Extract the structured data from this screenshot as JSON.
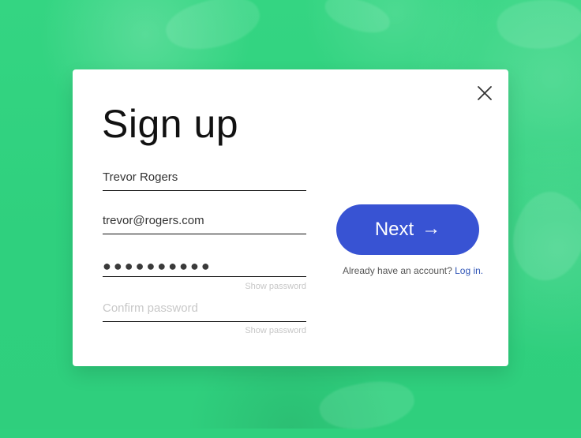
{
  "background": {
    "color": "#2fd07e"
  },
  "modal": {
    "title": "Sign up",
    "close_icon": "close-icon",
    "fields": {
      "name_value": "Trevor Rogers",
      "email_value": "trevor@rogers.com",
      "password_mask": "●●●●●●●●●●",
      "confirm_placeholder": "Confirm password",
      "show_password_label": "Show password"
    },
    "next_button": {
      "label": "Next",
      "icon": "→",
      "color": "#3853d3"
    },
    "login_prompt": {
      "text": "Already have an account?",
      "link": "Log in."
    }
  }
}
